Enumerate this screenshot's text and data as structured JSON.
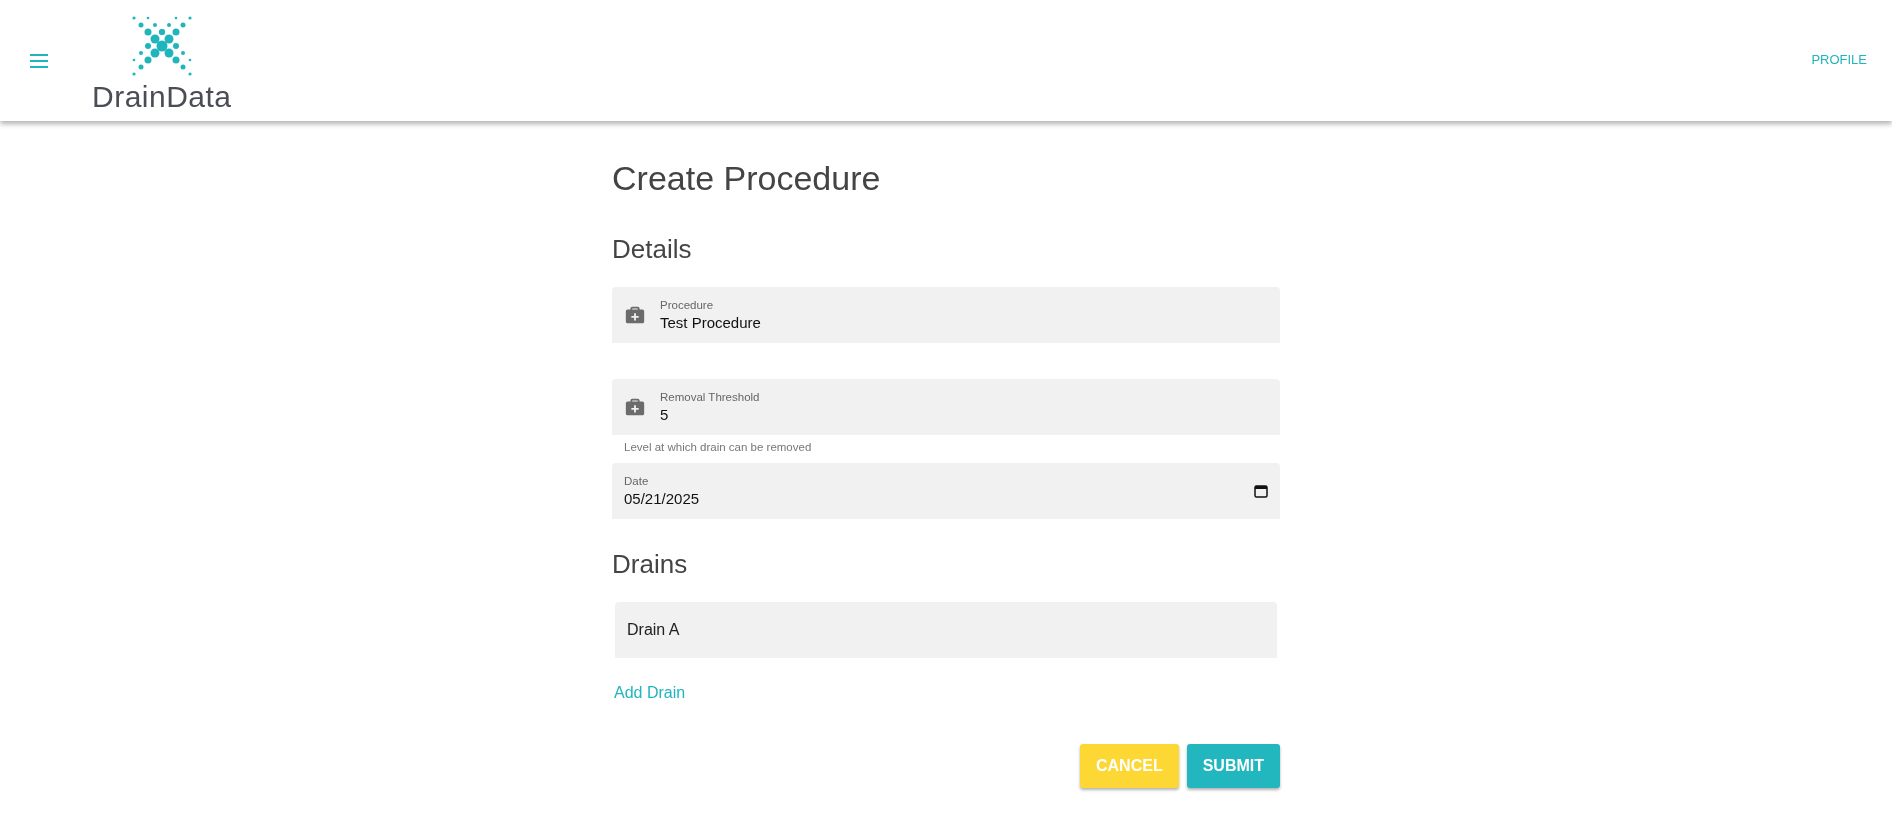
{
  "header": {
    "logo_text": "DrainData",
    "profile_link": "PROFILE"
  },
  "page": {
    "title": "Create Procedure",
    "details_heading": "Details",
    "fields": [
      {
        "kind": "icon-text",
        "label": "Procedure",
        "value": "Test Procedure"
      },
      {
        "kind": "icon-text",
        "label": "Removal Threshold",
        "value": "5",
        "helper": "Level at which drain can be removed"
      },
      {
        "kind": "date",
        "label": "Date",
        "value": "05/21/2025"
      }
    ],
    "drains_heading": "Drains",
    "drains": [
      "Drain A"
    ],
    "add_drain": "Add Drain",
    "buttons": [
      {
        "kind": "cancel",
        "label": "CANCEL"
      },
      {
        "kind": "submit",
        "label": "SUBMIT"
      }
    ]
  }
}
